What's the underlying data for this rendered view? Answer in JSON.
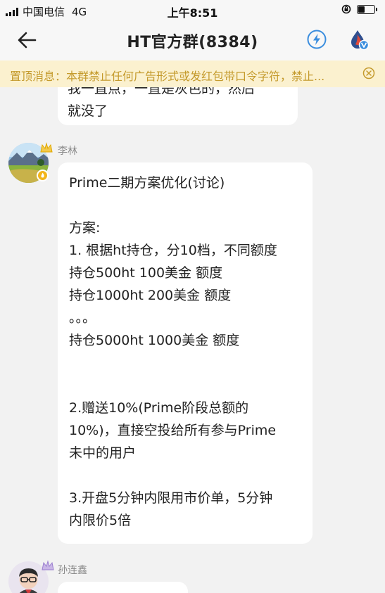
{
  "status_bar": {
    "carrier": "中国电信",
    "network": "4G",
    "time": "上午8:51"
  },
  "nav": {
    "title": "HT官方群(8384)",
    "icons": [
      "back-arrow-icon",
      "lightning-icon",
      "drop-v-badge-icon"
    ]
  },
  "notice": {
    "text": "置顶消息：本群禁止任何广告形式或发红包带口令字符，禁止..."
  },
  "messages": [
    {
      "sender": "",
      "lines": [
        "我一直点，一直是灰色的，然后",
        "就没了"
      ]
    },
    {
      "sender": "李林",
      "badge": "fire-icon",
      "lines": [
        "Prime二期方案优化(讨论)",
        "",
        "方案:",
        "1. 根据ht持仓，分10档，不同额度",
        "持仓500ht 100美金 额度",
        "持仓1000ht 200美金 额度",
        "。。。",
        "持仓5000ht  1000美金 额度",
        "",
        "",
        "2.赠送10%(Prime阶段总额的",
        "10%)，直接空投给所有参与Prime",
        "未中的用户",
        "",
        "3.开盘5分钟内限用市价单，5分钟",
        "内限价5倍"
      ]
    },
    {
      "sender": "孙连鑫",
      "lines": []
    }
  ],
  "colors": {
    "background": "#f2f2f2",
    "bubble": "#ffffff",
    "notice_bg": "#fbf1cf",
    "notice_text": "#c49a2c",
    "accent_blue": "#3a8dde"
  }
}
